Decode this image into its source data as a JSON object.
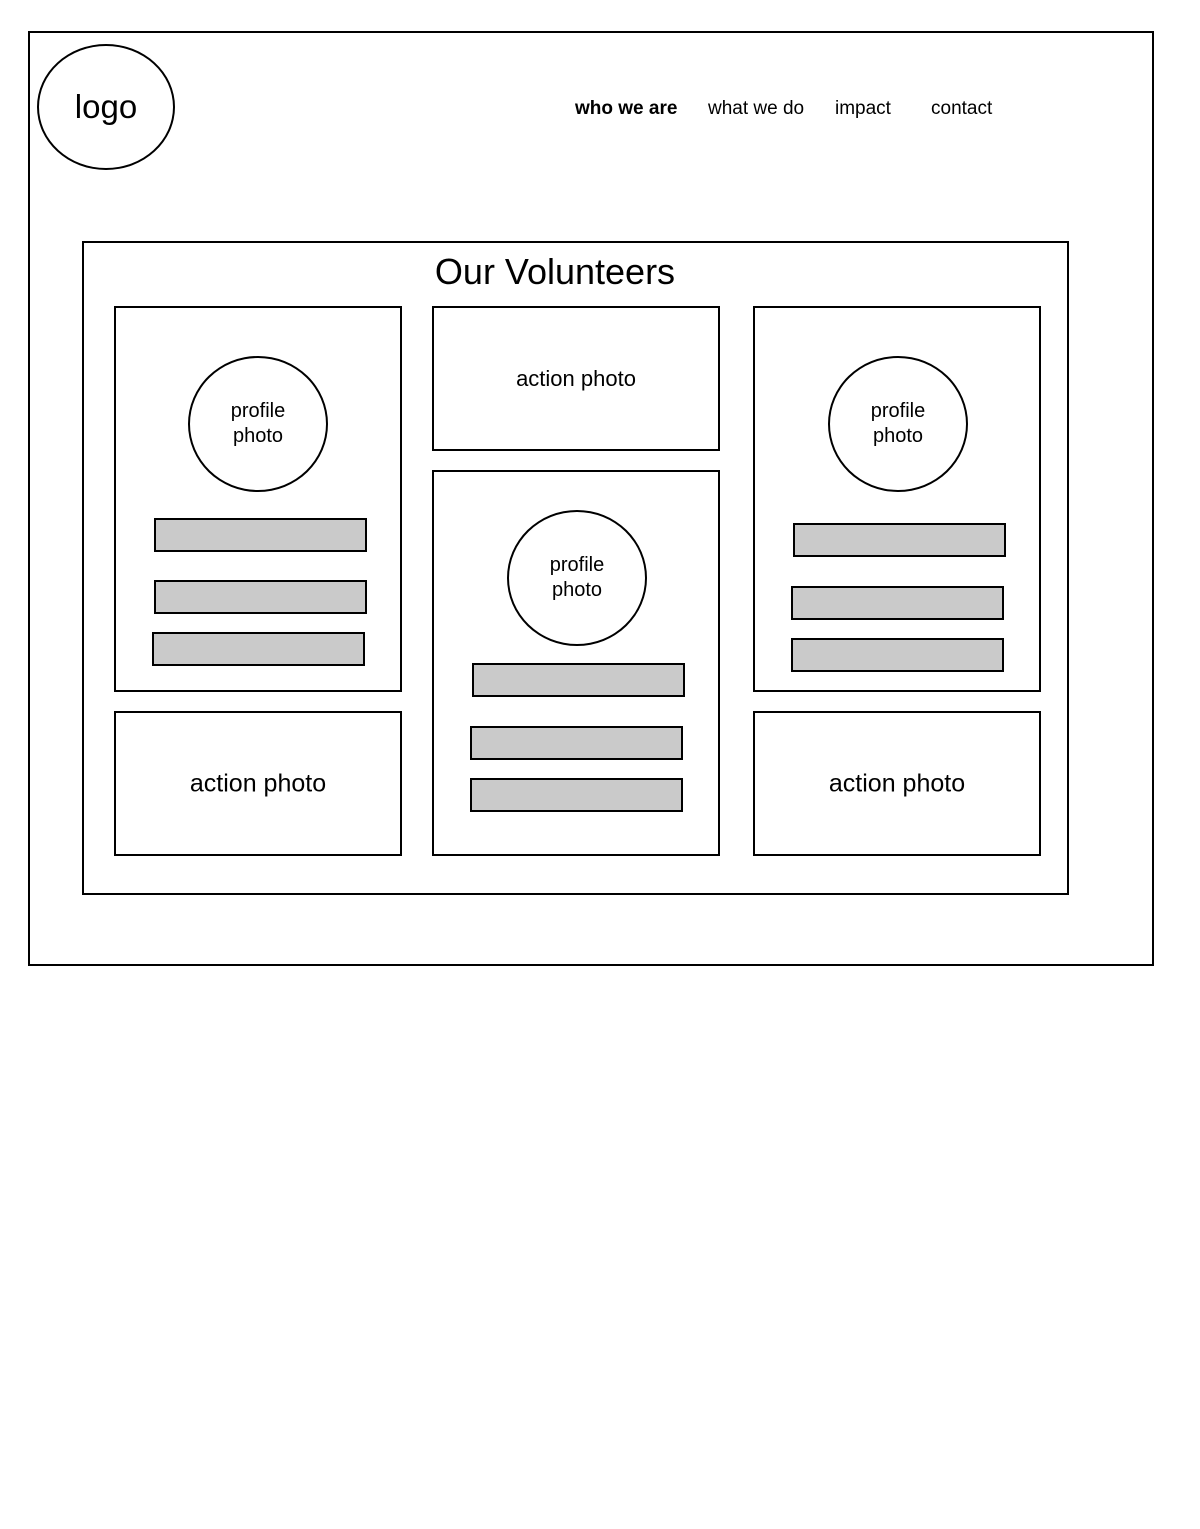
{
  "logo": {
    "label": "logo"
  },
  "nav": {
    "items": [
      {
        "label": "who we are",
        "active": true
      },
      {
        "label": "what we do",
        "active": false
      },
      {
        "label": "impact",
        "active": false
      },
      {
        "label": "contact",
        "active": false
      }
    ]
  },
  "section": {
    "title": "Our Volunteers"
  },
  "placeholders": {
    "action_photo": "action photo",
    "profile_photo": "profile\nphoto"
  },
  "colors": {
    "stroke": "#000000",
    "bar_fill": "#cacaca",
    "background": "#ffffff"
  }
}
